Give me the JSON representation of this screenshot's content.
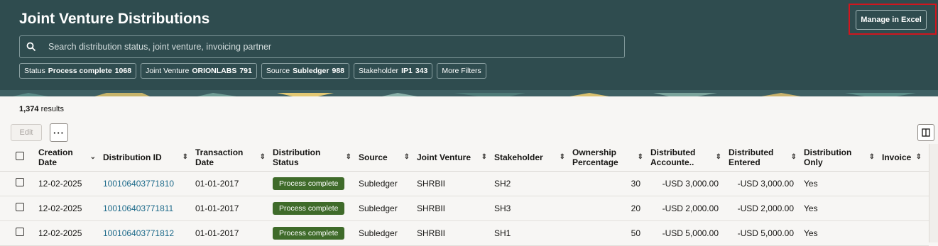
{
  "header": {
    "title": "Joint Venture Distributions",
    "manage_excel_label": "Manage in Excel",
    "search_placeholder": "Search distribution status, joint venture, invoicing partner",
    "chips": [
      {
        "label": "Status",
        "value": "Process complete",
        "count": "1068"
      },
      {
        "label": "Joint Venture",
        "value": "ORIONLABS",
        "count": "791"
      },
      {
        "label": "Source",
        "value": "Subledger",
        "count": "988"
      },
      {
        "label": "Stakeholder",
        "value": "IP1",
        "count": "343"
      }
    ],
    "more_filters_label": "More Filters"
  },
  "toolbar": {
    "results_count": "1,374",
    "results_suffix": "results",
    "edit_label": "Edit",
    "more_label": "···"
  },
  "table": {
    "columns": [
      "Creation Date",
      "Distribution ID",
      "Transaction Date",
      "Distribution Status",
      "Source",
      "Joint Venture",
      "Stakeholder",
      "Ownership Percentage",
      "Distributed Accounte..",
      "Distributed Entered",
      "Distribution Only",
      "Invoice"
    ],
    "rows": [
      {
        "creation_date": "12-02-2025",
        "distribution_id": "100106403771810",
        "transaction_date": "01-01-2017",
        "status": "Process complete",
        "source": "Subledger",
        "joint_venture": "SHRBII",
        "stakeholder": "SH2",
        "ownership": "30",
        "accounted": "-USD 3,000.00",
        "entered": "-USD 3,000.00",
        "distribution_only": "Yes",
        "invoice": ""
      },
      {
        "creation_date": "12-02-2025",
        "distribution_id": "100106403771811",
        "transaction_date": "01-01-2017",
        "status": "Process complete",
        "source": "Subledger",
        "joint_venture": "SHRBII",
        "stakeholder": "SH3",
        "ownership": "20",
        "accounted": "-USD 2,000.00",
        "entered": "-USD 2,000.00",
        "distribution_only": "Yes",
        "invoice": ""
      },
      {
        "creation_date": "12-02-2025",
        "distribution_id": "100106403771812",
        "transaction_date": "01-01-2017",
        "status": "Process complete",
        "source": "Subledger",
        "joint_venture": "SHRBII",
        "stakeholder": "SH1",
        "ownership": "50",
        "accounted": "-USD 5,000.00",
        "entered": "-USD 5,000.00",
        "distribution_only": "Yes",
        "invoice": ""
      }
    ]
  },
  "colors": {
    "header_bg": "#2f4c4f",
    "status_badge": "#3f6b2a",
    "link": "#1d6a8a",
    "highlight": "#d0161e"
  }
}
